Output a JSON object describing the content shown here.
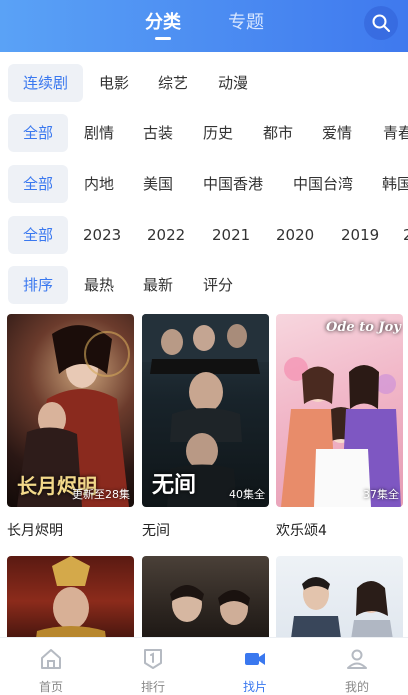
{
  "header": {
    "tabs": [
      {
        "label": "分类",
        "active": true
      },
      {
        "label": "专题",
        "active": false
      }
    ]
  },
  "filters": {
    "type": [
      "连续剧",
      "电影",
      "综艺",
      "动漫"
    ],
    "genre": [
      "全部",
      "剧情",
      "古装",
      "历史",
      "都市",
      "爱情",
      "青春"
    ],
    "region": [
      "全部",
      "内地",
      "美国",
      "中国香港",
      "中国台湾",
      "韩国"
    ],
    "year": [
      "全部",
      "2023",
      "2022",
      "2021",
      "2020",
      "2019",
      "2"
    ],
    "sort": [
      "排序",
      "最热",
      "最新",
      "评分"
    ]
  },
  "cards": [
    {
      "title": "长月烬明",
      "status": "更新至28集",
      "art": "长月烬明"
    },
    {
      "title": "无间",
      "status": "40集全",
      "art": "无间"
    },
    {
      "title": "欢乐颂4",
      "status": "37集全",
      "art": "Ode to Joy"
    },
    {
      "title": "",
      "status": "",
      "art": ""
    },
    {
      "title": "",
      "status": "",
      "art": ""
    },
    {
      "title": "",
      "status": "",
      "art": ""
    }
  ],
  "bottom_nav": [
    {
      "label": "首页",
      "icon": "home-icon",
      "active": false
    },
    {
      "label": "排行",
      "icon": "ranking-icon",
      "active": false
    },
    {
      "label": "找片",
      "icon": "video-icon",
      "active": true
    },
    {
      "label": "我的",
      "icon": "profile-icon",
      "active": false
    }
  ],
  "colors": {
    "accent": "#3a78ef",
    "header_start": "#5aa2f6",
    "header_end": "#3f79ee",
    "chip_bg": "#eef1f6"
  }
}
